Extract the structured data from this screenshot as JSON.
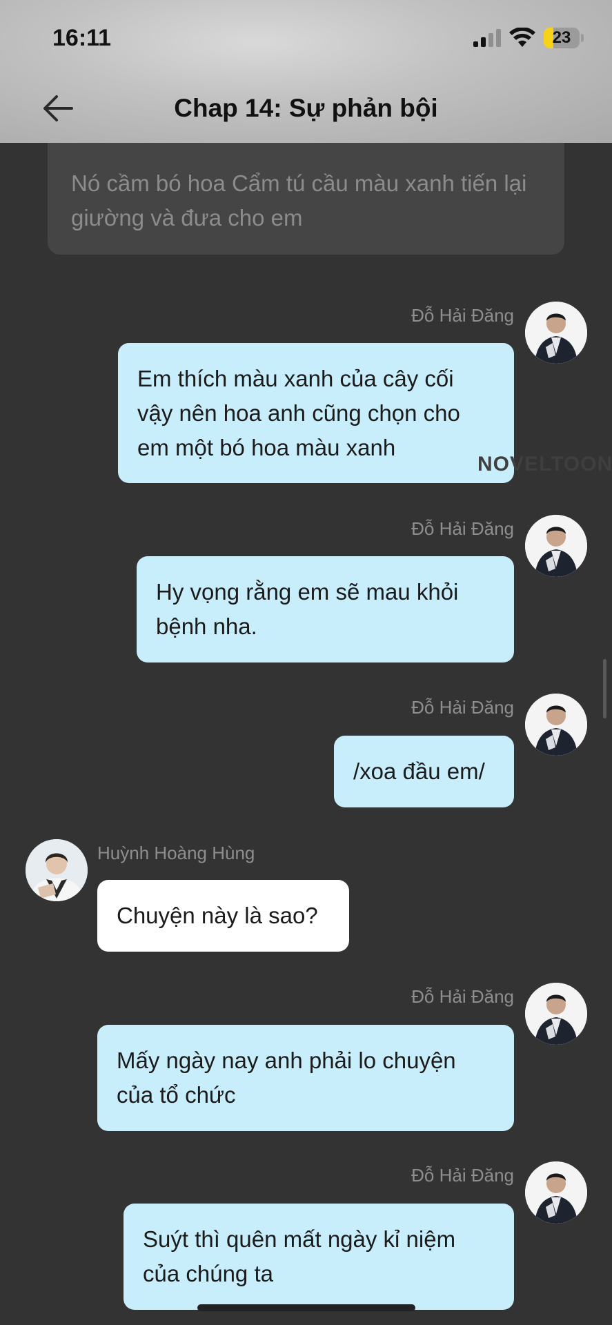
{
  "status_bar": {
    "time": "16:11",
    "battery": "23"
  },
  "header": {
    "title": "Chap 14: Sự phản bội"
  },
  "narration": {
    "text": "Nó cầm bó hoa Cẩm tú cầu màu xanh tiến lại giường và đưa cho em"
  },
  "watermark": "NOVELTOON",
  "messages": [
    {
      "sender": "Đỗ Hải Đăng",
      "side": "right",
      "text": "Em thích màu xanh của cây cối vậy nên hoa anh cũng chọn cho em một bó hoa màu xanh"
    },
    {
      "sender": "Đỗ Hải Đăng",
      "side": "right",
      "text": "Hy vọng rằng em sẽ mau khỏi bệnh nha."
    },
    {
      "sender": "Đỗ Hải Đăng",
      "side": "right",
      "text": "/xoa đầu em/"
    },
    {
      "sender": "Huỳnh Hoàng Hùng",
      "side": "left",
      "text": "Chuyện này là sao?"
    },
    {
      "sender": "Đỗ Hải Đăng",
      "side": "right",
      "text": "Mấy ngày nay anh phải lo chuyện của tổ chức"
    },
    {
      "sender": "Đỗ Hải Đăng",
      "side": "right",
      "text": "Suýt thì quên mất ngày kỉ niệm của chúng ta"
    }
  ],
  "colors": {
    "background": "#333333",
    "my_bubble": "#c8eefc",
    "other_bubble": "#ffffff",
    "narration_bubble": "#454545"
  }
}
